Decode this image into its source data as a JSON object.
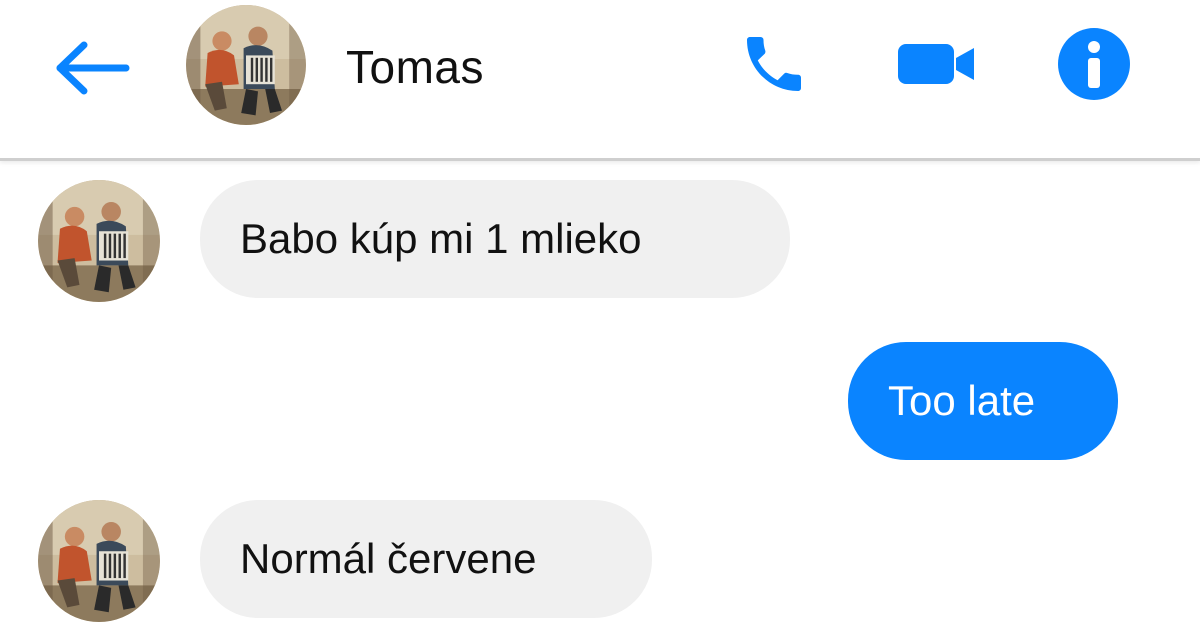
{
  "header": {
    "contact_name": "Tomas",
    "back_icon": "arrow-left-icon",
    "call_icon": "phone-icon",
    "video_icon": "video-camera-icon",
    "info_icon": "info-icon",
    "accent_color": "#0a84ff"
  },
  "messages": [
    {
      "direction": "incoming",
      "text": "Babo kúp mi 1 mlieko"
    },
    {
      "direction": "outgoing",
      "text": "Too late"
    },
    {
      "direction": "incoming",
      "text": "Normál červene"
    }
  ],
  "colors": {
    "incoming_bubble": "#f0f0f0",
    "outgoing_bubble": "#0a84ff",
    "incoming_text": "#111111",
    "outgoing_text": "#ffffff"
  }
}
